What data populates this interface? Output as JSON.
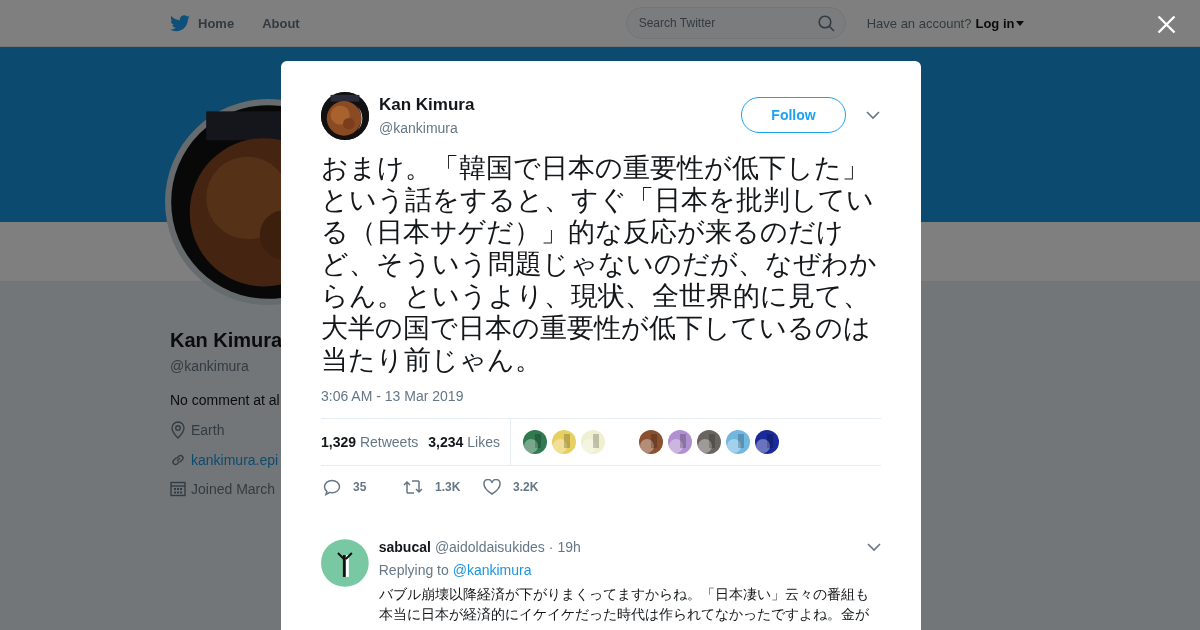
{
  "topbar": {
    "nav": [
      "Home",
      "About"
    ],
    "search": {
      "placeholder": "Search Twitter"
    },
    "account_prompt": "Have an account?",
    "login": "Log in"
  },
  "profile": {
    "name": "Kan Kimura",
    "handle": "@kankimura",
    "bio": "No comment at al",
    "location": "Earth",
    "website": "kankimura.epi",
    "joined": "Joined March"
  },
  "tweet": {
    "name": "Kan Kimura",
    "handle": "@kankimura",
    "follow": "Follow",
    "text": "おまけ。「韓国で日本の重要性が低下した」という話をすると、すぐ「日本を批判している（日本サゲだ）」的な反応が来るのだけど、そういう問題じゃないのだが、なぜわからん。というより、現状、全世界的に見て、大半の国で日本の重要性が低下しているのは当たり前じゃん。",
    "timestamp": "3:06 AM - 13 Mar 2019",
    "stats": [
      {
        "count": "1,329",
        "label": "Retweets"
      },
      {
        "count": "3,234",
        "label": "Likes"
      }
    ],
    "likers": [
      {
        "kind": "picture"
      },
      {
        "kind": "picture"
      },
      {
        "kind": "picture"
      },
      {
        "kind": "blank"
      },
      {
        "kind": "picture"
      },
      {
        "kind": "picture"
      },
      {
        "kind": "picture"
      },
      {
        "kind": "picture"
      },
      {
        "kind": "picture"
      }
    ],
    "actions": [
      {
        "kind": "reply",
        "count": "35"
      },
      {
        "kind": "retweet",
        "count": "1.3K"
      },
      {
        "kind": "like",
        "count": "3.2K"
      }
    ]
  },
  "reply": {
    "name": "sabucal",
    "handle": "@aidoldaisukides",
    "time": "· 19h",
    "replying_to": "Replying to",
    "mention": "@kankimura",
    "text": "バブル崩壊以降経済が下がりまくってますからね。「日本凄い」云々の番組も本当に日本が経済的にイケイケだった時代は作られてなかったですよね。金が"
  }
}
